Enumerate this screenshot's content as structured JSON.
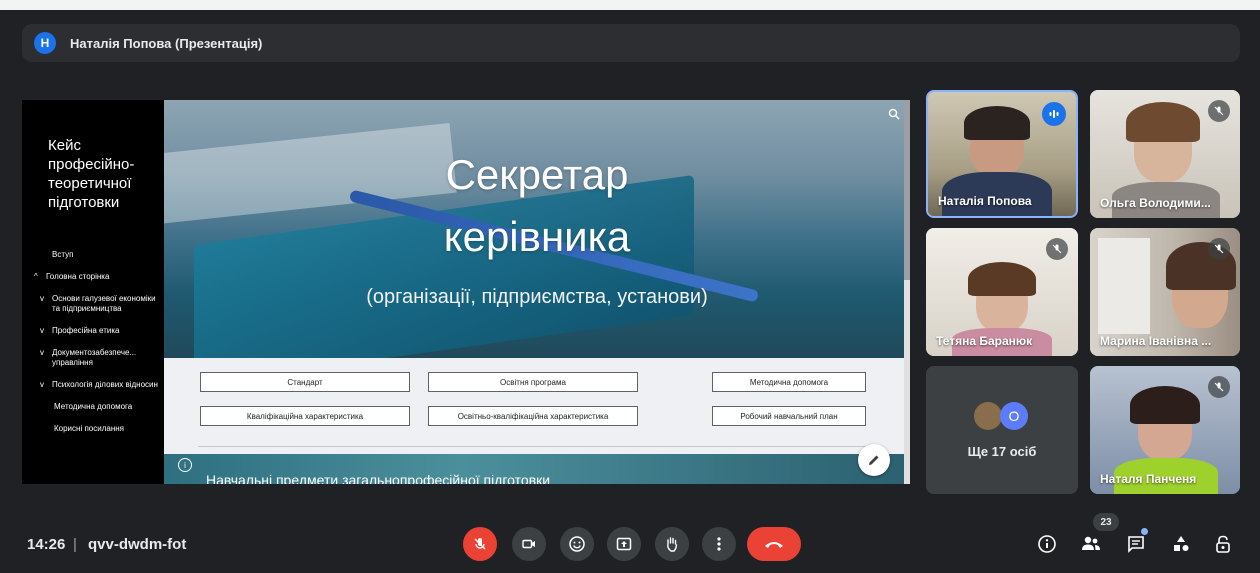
{
  "presenter": {
    "avatar_letter": "Н",
    "label": "Наталія Попова (Презентація)"
  },
  "site": {
    "title_lines": [
      "Кейс",
      "професійно-",
      "теоретичної",
      "підготовки"
    ],
    "nav": [
      {
        "label": "Вступ",
        "chevron": ""
      },
      {
        "label": "Головна сторінка",
        "chevron": "^"
      },
      {
        "label": "Основи галузевої економіки та підприємництва",
        "chevron": "v"
      },
      {
        "label": "Професійна етика",
        "chevron": "v"
      },
      {
        "label": "Документозабезпече... управління",
        "chevron": "v"
      },
      {
        "label": "Психологія ділових відносин",
        "chevron": "v"
      },
      {
        "label": "Методична допомога",
        "chevron": ""
      },
      {
        "label": "Корисні посилання",
        "chevron": ""
      }
    ]
  },
  "slide": {
    "title_line1": "Секретар",
    "title_line2": "керівника",
    "subtitle": "(організації, підприємства, установи)",
    "links": [
      "Стандарт",
      "Освітня програма",
      "Методична допомога",
      "Кваліфікаційна характеристика",
      "Освітньо-кваліфікаційна характеристика",
      "Робочий навчальний план"
    ],
    "bottom_text": "Навчальні предмети загальнопрофесійної підготовки"
  },
  "participants": [
    {
      "name": "Наталія Попова",
      "state": "speaking"
    },
    {
      "name": "Ольга Володими...",
      "state": "muted"
    },
    {
      "name": "Тетяна Баранюк",
      "state": "muted"
    },
    {
      "name": "Марина Іванівна ...",
      "state": "muted"
    },
    {
      "name": "Наталя Панченя",
      "state": "muted"
    }
  ],
  "others": {
    "label": "Ще 17 осіб",
    "avatar_letter": "О"
  },
  "meeting": {
    "time": "14:26",
    "separator": "|",
    "code": "qvv-dwdm-fot",
    "participant_count": "23"
  },
  "controls": [
    "mic-off-icon",
    "camera-icon",
    "emoji-icon",
    "present-icon",
    "raise-hand-icon",
    "more-icon",
    "hang-up-icon"
  ],
  "colors": {
    "accent": "#1a73e8",
    "danger": "#ea4335",
    "background": "#202124",
    "surface": "#3c4043"
  }
}
